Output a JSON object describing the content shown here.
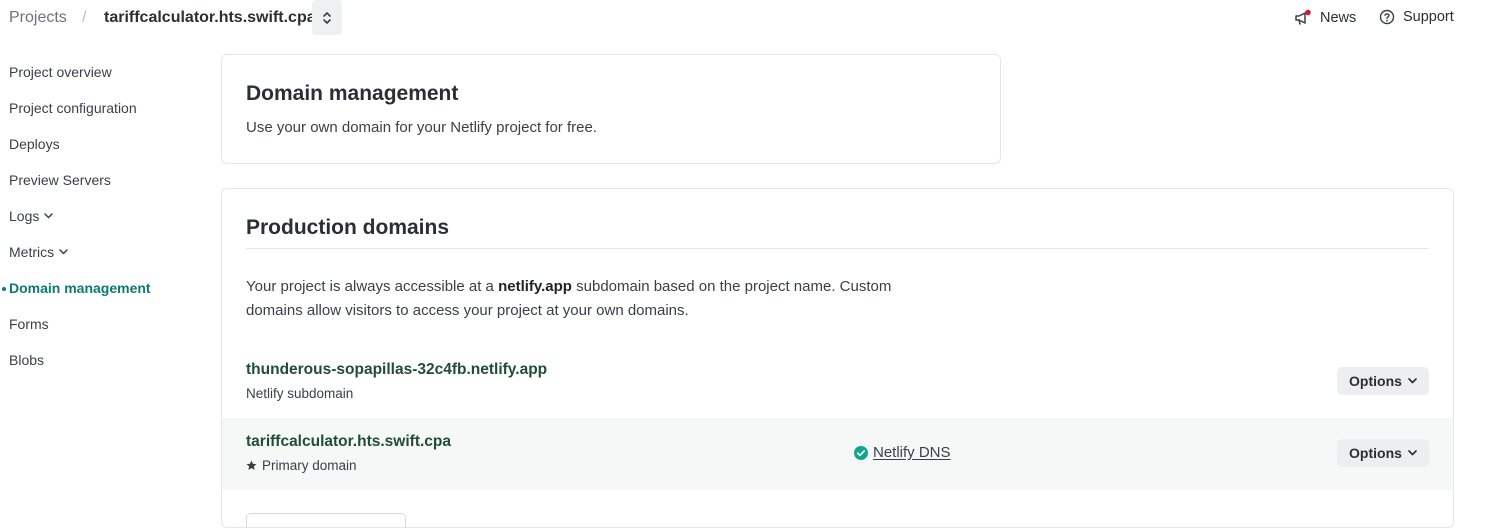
{
  "header": {
    "projects_label": "Projects",
    "separator": "/",
    "site_name": "tariffcalculator.hts.swift.cpa",
    "news_label": "News",
    "support_label": "Support",
    "news_has_notification": true
  },
  "sidebar": {
    "items": [
      {
        "label": "Project overview"
      },
      {
        "label": "Project configuration"
      },
      {
        "label": "Deploys"
      },
      {
        "label": "Preview Servers"
      },
      {
        "label": "Logs"
      },
      {
        "label": "Metrics"
      },
      {
        "label": "Domain management"
      },
      {
        "label": "Forms"
      },
      {
        "label": "Blobs"
      }
    ],
    "active": "Domain management"
  },
  "domain_card": {
    "title": "Domain management",
    "description": "Use your own domain for your Netlify project for free."
  },
  "production": {
    "title": "Production domains",
    "para_before": "Your project is always accessible at a ",
    "para_bold": "netlify.app",
    "para_after": " subdomain based on the project name. Custom domains allow visitors to access your project at your own domains.",
    "domains": [
      {
        "name": "thunderous-sopapillas-32c4fb.netlify.app",
        "sub": "Netlify subdomain",
        "options_label": "Options"
      },
      {
        "name": "tariffcalculator.hts.swift.cpa",
        "sub": "Primary domain",
        "dns_label": "Netlify DNS",
        "options_label": "Options"
      }
    ]
  },
  "colors": {
    "accent": "#0b7a70",
    "dns_check": "#11a58f",
    "notification": "#d4163c"
  },
  "icons": [
    "chevron-up-down-icon",
    "megaphone-icon",
    "question-circle-icon",
    "chevron-down-icon",
    "star-icon",
    "check-circle-icon"
  ]
}
